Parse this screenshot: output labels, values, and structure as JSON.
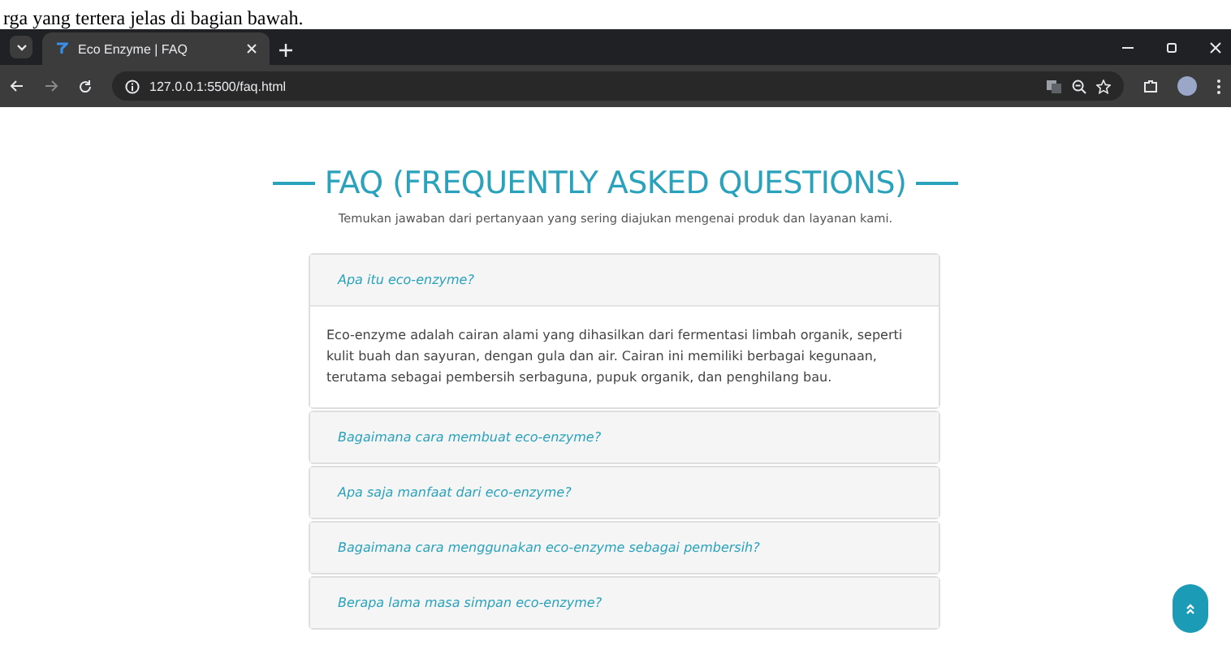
{
  "document_text": "rga yang tertera jelas di bagian bawah.",
  "browser": {
    "tab_title": "Eco Enzyme | FAQ",
    "url": "127.0.0.1:5500/faq.html"
  },
  "page": {
    "title": "FAQ (FREQUENTLY ASKED QUESTIONS)",
    "subtitle": "Temukan jawaban dari pertanyaan yang sering diajukan mengenai produk dan layanan kami.",
    "faqs": [
      {
        "question": "Apa itu eco-enzyme?",
        "answer": "Eco-enzyme adalah cairan alami yang dihasilkan dari fermentasi limbah organik, seperti kulit buah dan sayuran, dengan gula dan air. Cairan ini memiliki berbagai kegunaan, terutama sebagai pembersih serbaguna, pupuk organik, dan penghilang bau."
      },
      {
        "question": "Bagaimana cara membuat eco-enzyme?"
      },
      {
        "question": "Apa saja manfaat dari eco-enzyme?"
      },
      {
        "question": "Bagaimana cara menggunakan eco-enzyme sebagai pembersih?"
      },
      {
        "question": "Berapa lama masa simpan eco-enzyme?"
      }
    ]
  }
}
